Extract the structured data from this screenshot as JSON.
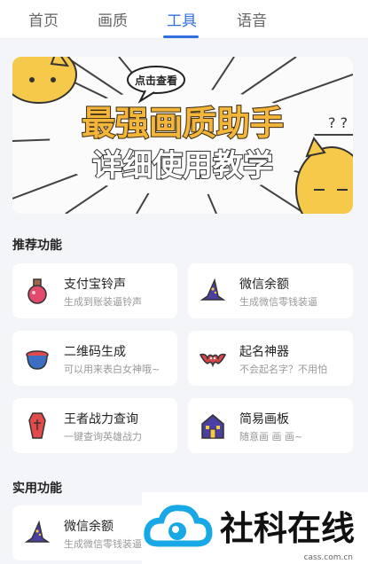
{
  "tabs": [
    {
      "label": "首页"
    },
    {
      "label": "画质"
    },
    {
      "label": "工具"
    },
    {
      "label": "语音"
    }
  ],
  "active_tab": "工具",
  "banner": {
    "bubble": "点击查看",
    "line1": "最强画质助手",
    "line2": "详细使用教学"
  },
  "sections": {
    "recommended": "推荐功能",
    "practical": "实用功能"
  },
  "cards": [
    {
      "title": "支付宝铃声",
      "sub": "生成到账装逼铃声",
      "icon": "potion-icon"
    },
    {
      "title": "微信余额",
      "sub": "生成微信零钱装逼",
      "icon": "wizard-hat-icon"
    },
    {
      "title": "二维码生成",
      "sub": "可以用来表白女神哦~",
      "icon": "cauldron-icon"
    },
    {
      "title": "起名神器",
      "sub": "不会起名字？不用怕",
      "icon": "bat-icon"
    },
    {
      "title": "王者战力查询",
      "sub": "一键查询英雄战力",
      "icon": "coffin-icon"
    },
    {
      "title": "简易画板",
      "sub": "随意画 画 画~",
      "icon": "haunted-house-icon"
    }
  ],
  "practical_cards": [
    {
      "title": "微信余额",
      "sub": "生成微信零钱装逼",
      "icon": "wizard-hat-icon"
    }
  ],
  "watermark": {
    "brand": "社科在线",
    "url": "cass.com.cn"
  },
  "colors": {
    "accent": "#2f6fe0",
    "banner_text": "#f4b63a",
    "icon_purple": "#4b3fa0",
    "icon_red": "#e34b4b"
  }
}
